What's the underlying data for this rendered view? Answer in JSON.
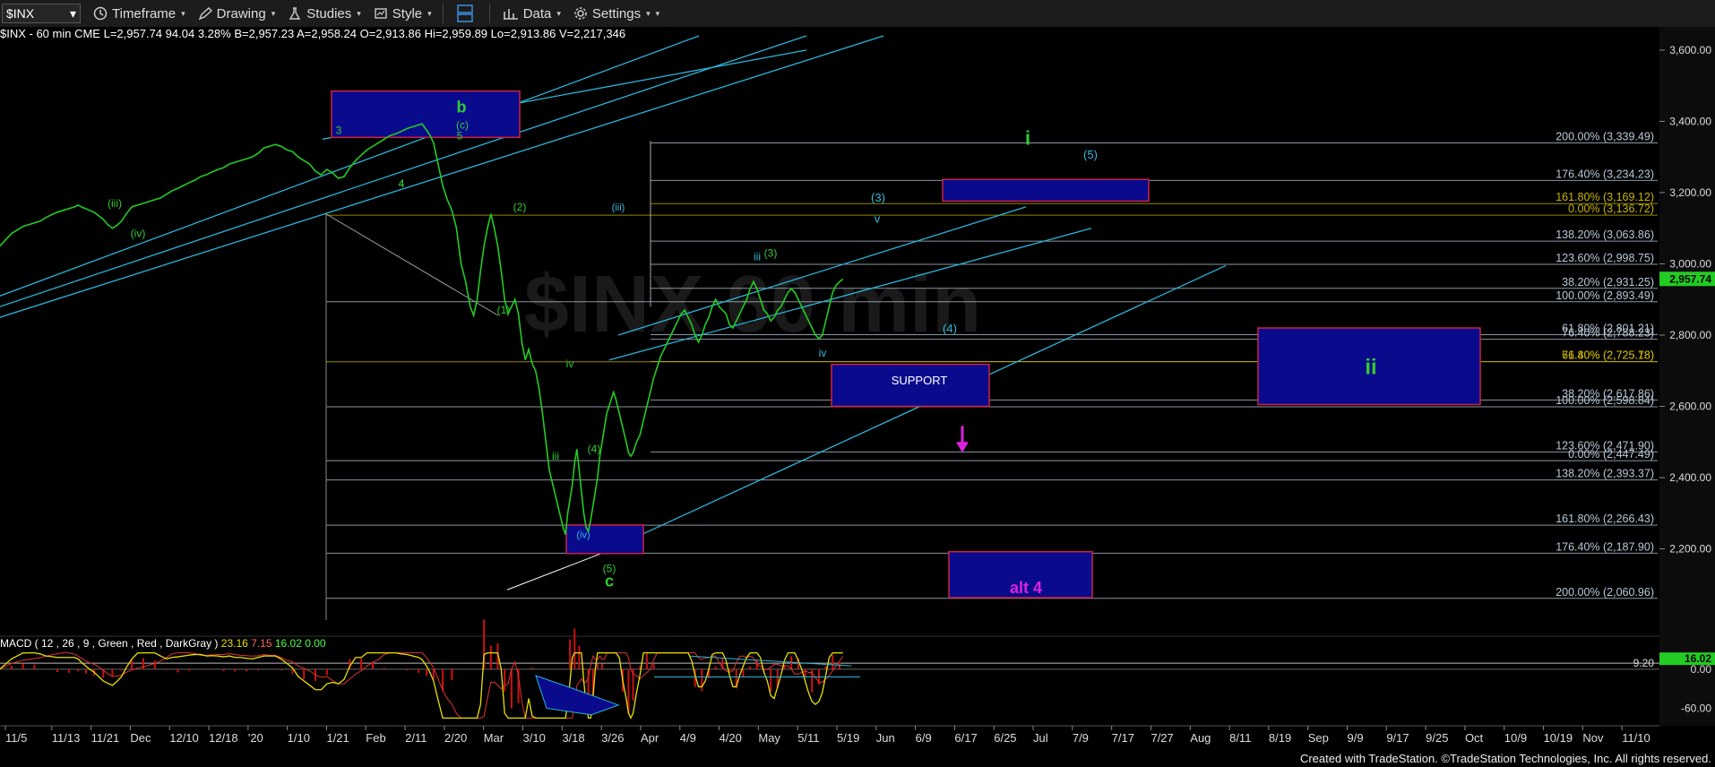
{
  "toolbar": {
    "symbol": "$INX",
    "timeframe": "Timeframe",
    "drawing": "Drawing",
    "studies": "Studies",
    "style": "Style",
    "data": "Data",
    "settings": "Settings"
  },
  "header": {
    "symbol_info": "$INX - 60 min  CME",
    "last": "L=2,957.74",
    "change": "94.04",
    "change_pct": "3.28%",
    "bid": "B=2,957.23",
    "ask": "A=2,958.24",
    "open": "O=2,913.86",
    "high": "Hi=2,959.89",
    "low": "Lo=2,913.86",
    "volume": "V=2,217,346"
  },
  "macd_info": {
    "label": "MACD ( 12 , 26 , 9 , Green , Red , DarkGray )",
    "v1": "23.16",
    "v2": "7.15",
    "v3": "16.02",
    "v4": "0.00"
  },
  "footer": "Created with TradeStation. ©TradeStation Technologies, Inc. All rights reserved.",
  "colors": {
    "price": "#22cc22",
    "fib": "#b8c8d8",
    "fib_yellow": "#c8b400",
    "channel": "#2ab4d8",
    "box_fill": "#0a0a8c",
    "box_border": "#cc2244",
    "green_label": "#33cc33",
    "cyan_label": "#33bbdd",
    "magenta": "#dd22dd"
  },
  "chart_data": {
    "type": "line",
    "title": "$INX - 60 min",
    "ylim": [
      1980,
      3640
    ],
    "price_ticks": [
      "3,600.00",
      "3,400.00",
      "3,200.00",
      "3,000.00",
      "2,800.00",
      "2,600.00",
      "2,400.00",
      "2,200.00"
    ],
    "last_price_label": "2,957.74",
    "x_ticks": [
      "11/5",
      "11/13",
      "11/21",
      "Dec",
      "12/10",
      "12/18",
      "'20",
      "1/10",
      "1/21",
      "Feb",
      "2/11",
      "2/20",
      "Mar",
      "3/10",
      "3/18",
      "3/26",
      "Apr",
      "4/9",
      "4/20",
      "May",
      "5/11",
      "5/19",
      "Jun",
      "6/9",
      "6/17",
      "6/25",
      "Jul",
      "7/9",
      "7/17",
      "7/27",
      "Aug",
      "8/11",
      "8/19",
      "Sep",
      "9/9",
      "9/17",
      "9/25",
      "Oct",
      "10/9",
      "10/19",
      "Nov",
      "11/10"
    ],
    "series": [
      {
        "points": [
          [
            0,
            3050
          ],
          [
            5,
            3068
          ],
          [
            10,
            3085
          ],
          [
            15,
            3095
          ],
          [
            20,
            3105
          ],
          [
            25,
            3110
          ],
          [
            30,
            3115
          ],
          [
            35,
            3120
          ],
          [
            40,
            3130
          ],
          [
            45,
            3138
          ],
          [
            50,
            3145
          ],
          [
            55,
            3150
          ],
          [
            60,
            3155
          ],
          [
            65,
            3160
          ],
          [
            68,
            3165
          ],
          [
            72,
            3158
          ],
          [
            75,
            3155
          ],
          [
            78,
            3150
          ],
          [
            82,
            3145
          ],
          [
            86,
            3135
          ],
          [
            90,
            3125
          ],
          [
            94,
            3110
          ],
          [
            98,
            3100
          ],
          [
            102,
            3108
          ],
          [
            106,
            3120
          ],
          [
            110,
            3140
          ],
          [
            115,
            3160
          ],
          [
            120,
            3165
          ],
          [
            125,
            3170
          ],
          [
            130,
            3175
          ],
          [
            135,
            3180
          ],
          [
            140,
            3185
          ],
          [
            145,
            3195
          ],
          [
            150,
            3205
          ],
          [
            155,
            3212
          ],
          [
            160,
            3220
          ],
          [
            165,
            3228
          ],
          [
            170,
            3235
          ],
          [
            175,
            3245
          ],
          [
            180,
            3250
          ],
          [
            185,
            3258
          ],
          [
            190,
            3265
          ],
          [
            195,
            3270
          ],
          [
            200,
            3280
          ],
          [
            205,
            3285
          ],
          [
            210,
            3290
          ],
          [
            215,
            3295
          ],
          [
            220,
            3300
          ],
          [
            225,
            3310
          ],
          [
            230,
            3325
          ],
          [
            235,
            3330
          ],
          [
            240,
            3335
          ],
          [
            245,
            3330
          ],
          [
            250,
            3320
          ],
          [
            255,
            3315
          ],
          [
            260,
            3300
          ],
          [
            265,
            3290
          ],
          [
            270,
            3280
          ],
          [
            275,
            3260
          ],
          [
            280,
            3250
          ],
          [
            285,
            3265
          ],
          [
            290,
            3255
          ],
          [
            295,
            3240
          ],
          [
            300,
            3245
          ],
          [
            305,
            3270
          ],
          [
            310,
            3290
          ],
          [
            315,
            3305
          ],
          [
            320,
            3320
          ],
          [
            325,
            3330
          ],
          [
            330,
            3340
          ],
          [
            335,
            3350
          ],
          [
            340,
            3360
          ],
          [
            345,
            3365
          ],
          [
            350,
            3372
          ],
          [
            355,
            3380
          ],
          [
            360,
            3385
          ],
          [
            365,
            3390
          ],
          [
            368,
            3393
          ],
          [
            372,
            3375
          ],
          [
            375,
            3360
          ],
          [
            378,
            3340
          ],
          [
            382,
            3280
          ],
          [
            386,
            3220
          ],
          [
            390,
            3180
          ],
          [
            394,
            3150
          ],
          [
            398,
            3100
          ],
          [
            402,
            3000
          ],
          [
            406,
            2950
          ],
          [
            410,
            2880
          ],
          [
            413,
            2855
          ],
          [
            416,
            2900
          ],
          [
            419,
            2980
          ],
          [
            422,
            3050
          ],
          [
            425,
            3100
          ],
          [
            428,
            3140
          ],
          [
            431,
            3100
          ],
          [
            434,
            3050
          ],
          [
            437,
            2980
          ],
          [
            440,
            2900
          ],
          [
            443,
            2860
          ],
          [
            446,
            2880
          ],
          [
            449,
            2900
          ],
          [
            452,
            2860
          ],
          [
            455,
            2780
          ],
          [
            458,
            2730
          ],
          [
            461,
            2760
          ],
          [
            464,
            2720
          ],
          [
            467,
            2700
          ],
          [
            470,
            2650
          ],
          [
            473,
            2580
          ],
          [
            476,
            2500
          ],
          [
            479,
            2420
          ],
          [
            482,
            2380
          ],
          [
            485,
            2340
          ],
          [
            488,
            2300
          ],
          [
            491,
            2260
          ],
          [
            493,
            2240
          ],
          [
            495,
            2300
          ],
          [
            497,
            2340
          ],
          [
            499,
            2380
          ],
          [
            501,
            2440
          ],
          [
            503,
            2480
          ],
          [
            505,
            2420
          ],
          [
            507,
            2360
          ],
          [
            509,
            2300
          ],
          [
            511,
            2260
          ],
          [
            513,
            2250
          ],
          [
            515,
            2280
          ],
          [
            517,
            2320
          ],
          [
            519,
            2360
          ],
          [
            521,
            2400
          ],
          [
            523,
            2460
          ],
          [
            525,
            2500
          ],
          [
            527,
            2540
          ],
          [
            529,
            2580
          ],
          [
            531,
            2600
          ],
          [
            533,
            2620
          ],
          [
            535,
            2640
          ],
          [
            537,
            2620
          ],
          [
            540,
            2580
          ],
          [
            543,
            2540
          ],
          [
            546,
            2500
          ],
          [
            548,
            2470
          ],
          [
            550,
            2460
          ],
          [
            552,
            2470
          ],
          [
            555,
            2500
          ],
          [
            558,
            2520
          ],
          [
            561,
            2560
          ],
          [
            564,
            2600
          ],
          [
            567,
            2640
          ],
          [
            570,
            2680
          ],
          [
            573,
            2710
          ],
          [
            576,
            2740
          ],
          [
            579,
            2760
          ],
          [
            582,
            2780
          ],
          [
            585,
            2800
          ],
          [
            588,
            2820
          ],
          [
            591,
            2840
          ],
          [
            594,
            2860
          ],
          [
            597,
            2870
          ],
          [
            600,
            2850
          ],
          [
            603,
            2830
          ],
          [
            606,
            2800
          ],
          [
            609,
            2780
          ],
          [
            612,
            2800
          ],
          [
            615,
            2830
          ],
          [
            618,
            2850
          ],
          [
            621,
            2880
          ],
          [
            624,
            2900
          ],
          [
            627,
            2880
          ],
          [
            630,
            2870
          ],
          [
            633,
            2860
          ],
          [
            636,
            2830
          ],
          [
            639,
            2820
          ],
          [
            642,
            2840
          ],
          [
            645,
            2860
          ],
          [
            648,
            2880
          ],
          [
            651,
            2900
          ],
          [
            654,
            2930
          ],
          [
            657,
            2950
          ],
          [
            660,
            2930
          ],
          [
            663,
            2900
          ],
          [
            666,
            2870
          ],
          [
            669,
            2860
          ],
          [
            672,
            2840
          ],
          [
            675,
            2850
          ],
          [
            678,
            2870
          ],
          [
            681,
            2880
          ],
          [
            684,
            2900
          ],
          [
            687,
            2920
          ],
          [
            690,
            2930
          ],
          [
            693,
            2920
          ],
          [
            696,
            2900
          ],
          [
            699,
            2880
          ],
          [
            702,
            2860
          ],
          [
            705,
            2840
          ],
          [
            708,
            2820
          ],
          [
            711,
            2800
          ],
          [
            714,
            2790
          ],
          [
            717,
            2800
          ],
          [
            720,
            2840
          ],
          [
            723,
            2880
          ],
          [
            726,
            2920
          ],
          [
            729,
            2940
          ],
          [
            732,
            2950
          ],
          [
            735,
            2957
          ]
        ]
      }
    ],
    "fib_levels": [
      {
        "label": "200.00% (3,339.49)",
        "value": 3339.49
      },
      {
        "label": "176.40% (3,234.23)",
        "value": 3234.23
      },
      {
        "label": "161.80% (3,169.12)",
        "value": 3169.12
      },
      {
        "label": "0.00% (3,136.72)",
        "value": 3136.72
      },
      {
        "label": "138.20% (3,063.86)",
        "value": 3063.86
      },
      {
        "label": "123.60% (2,998.75)",
        "value": 2998.75
      },
      {
        "label": "38.20% (2,931.25)",
        "value": 2931.25
      },
      {
        "label": "100.00% (2,893.49)",
        "value": 2893.49
      },
      {
        "label": "61.80% (2,801.21)",
        "value": 2801.21
      },
      {
        "label": "76.40% (2,788.23)",
        "value": 2788.23
      },
      {
        "label": "61.80% (2,725.18)",
        "value": 2725.18
      },
      {
        "label": "76.40% (2,725.78)",
        "value": 2725.78
      },
      {
        "label": "38.20% (2,617.86)",
        "value": 2617.86
      },
      {
        "label": "100.00% (2,598.84)",
        "value": 2598.84
      },
      {
        "label": "123.60% (2,471.90)",
        "value": 2471.9
      },
      {
        "label": "0.00% (2,447.49)",
        "value": 2447.49
      },
      {
        "label": "138.20% (2,393.37)",
        "value": 2393.37
      },
      {
        "label": "161.80% (2,266.43)",
        "value": 2266.43
      },
      {
        "label": "176.40% (2,187.90)",
        "value": 2187.9
      },
      {
        "label": "200.00% (2,060.96)",
        "value": 2060.96
      }
    ],
    "wave_labels_green": [
      "b",
      "i",
      "ii",
      "c",
      "4",
      "(1)",
      "(2)",
      "(3)",
      "(4)",
      "(5)",
      "(c)",
      "iii",
      "iv",
      "(iii)",
      "(iv)",
      "3",
      "4",
      "5"
    ],
    "wave_labels_cyan": [
      "(3)",
      "(4)",
      "(5)",
      "v",
      "iii",
      "iv",
      "(iii)",
      "(iv)"
    ],
    "annotations": {
      "support": "SUPPORT",
      "alt4": "alt 4",
      "watermark": "$INX 60 min"
    },
    "macd": {
      "ylim": [
        -80,
        30
      ],
      "ticks": [
        "9.20",
        "0.00",
        "-60.00"
      ],
      "last_label": "16.02"
    }
  }
}
